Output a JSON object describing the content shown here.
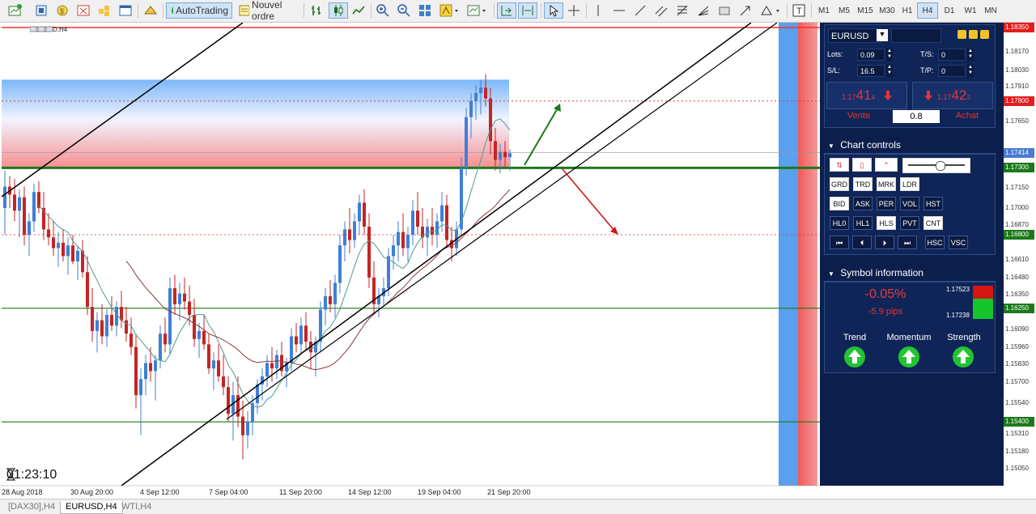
{
  "toolbar": {
    "autotrading_label": "AutoTrading",
    "new_order_label": "Nouvel ordre",
    "timeframes": [
      "M1",
      "M5",
      "M15",
      "M30",
      "H1",
      "H4",
      "D1",
      "W1",
      "MN"
    ],
    "active_timeframe": "H4"
  },
  "chart": {
    "title": "EURUSD,H4",
    "timer": "01:23:10",
    "price_labels": [
      "1.18350",
      "1.18030",
      "1.18170",
      "1.17910",
      "1.17800",
      "1.17650",
      "1.17414",
      "1.17300",
      "1.17150",
      "1.17000",
      "1.16870",
      "1.16800",
      "1.16610",
      "1.16480",
      "1.16350",
      "1.16250",
      "1.16090",
      "1.15960",
      "1.15830",
      "1.15700",
      "1.15540",
      "1.15400",
      "1.15310",
      "1.15180",
      "1.15050"
    ],
    "highlighted_prices": {
      "1.18350": "#e21d1d",
      "1.17800": "#e21d1d",
      "1.17414": "#4a7bd0",
      "1.17300": "#1a7a1a",
      "1.16800": "#1a7a1a",
      "1.16250": "#1a7a1a",
      "1.15400": "#1a7a1a"
    },
    "date_labels": [
      "28 Aug 2018",
      "30 Aug 20:00",
      "4 Sep 12:00",
      "7 Sep 04:00",
      "11 Sep 20:00",
      "14 Sep 12:00",
      "19 Sep 04:00",
      "21 Sep 20:00"
    ],
    "colors": {
      "bull": "#3f7fd6",
      "bear": "#c52424",
      "support": "#1a7a1a",
      "trend": "#000000",
      "up_arrow": "#1a7a1a",
      "down_arrow": "#d01818"
    }
  },
  "panel": {
    "symbol": "EURUSD",
    "lots_label": "Lots:",
    "lots_value": "0.09",
    "ts_label": "T/S:",
    "ts_value": "0",
    "sl_label": "S/L:",
    "sl_value": "16.5",
    "tp_label": "T/P:",
    "tp_value": "0",
    "sell_prefix": "1.17",
    "sell_big": "41",
    "sell_small": "4",
    "buy_prefix": "1.17",
    "buy_big": "42",
    "buy_small": "2",
    "sell_label": "Vente",
    "buy_label": "Achat",
    "spread": "0.8",
    "chart_controls_title": "Chart controls",
    "row1": [
      "GRD",
      "TRD",
      "MRK",
      "LDR"
    ],
    "row2": [
      "BID",
      "ASK",
      "PER",
      "VOL",
      "HST"
    ],
    "row3": [
      "HL0",
      "HL1",
      "HLS",
      "PVT",
      "CNT"
    ],
    "row4_extra": [
      "HSC",
      "VSC"
    ],
    "symbol_info_title": "Symbol information",
    "change_pct": "-0.05%",
    "change_pips": "-5.9 pips",
    "high": "1.17523",
    "low": "1.17238",
    "trend_label": "Trend",
    "momentum_label": "Momentum",
    "strength_label": "Strength"
  },
  "status_tabs": [
    "[DAX30],H4",
    "EURUSD,H4",
    "WTI,H4"
  ],
  "active_tab": "EURUSD,H4"
}
